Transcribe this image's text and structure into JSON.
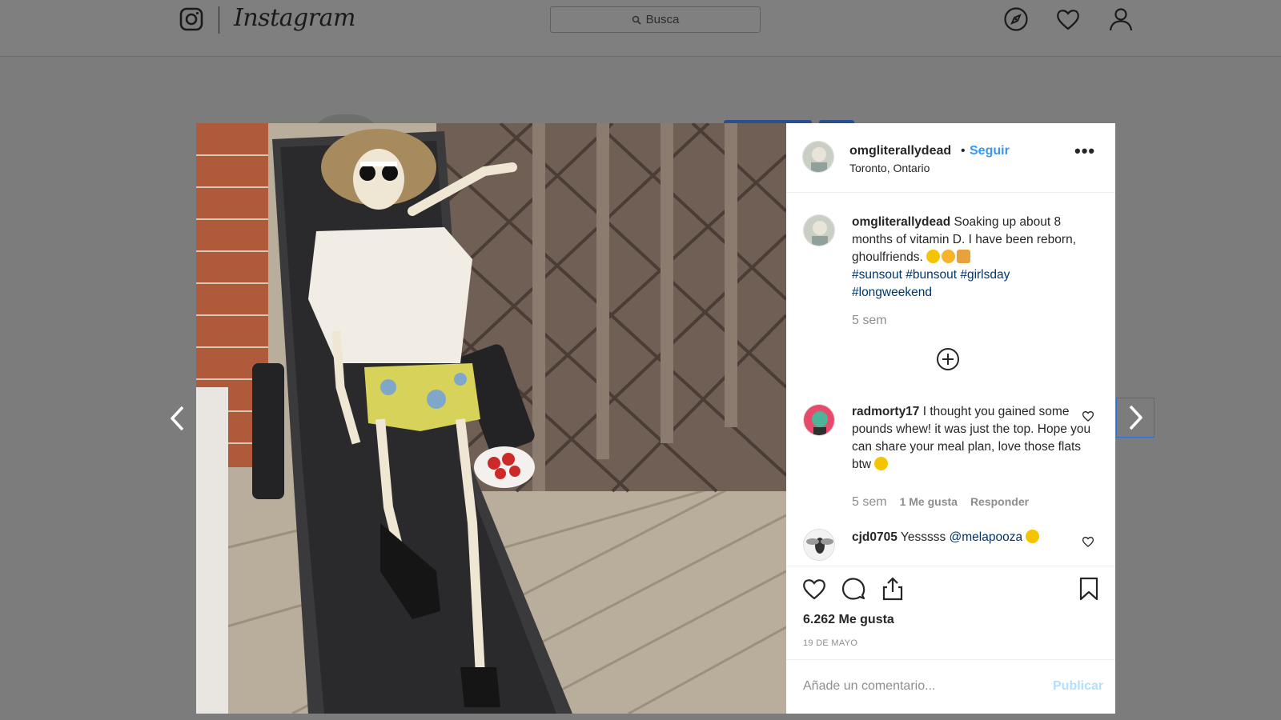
{
  "topbar": {
    "brand": "Instagram",
    "search_placeholder": "Busca",
    "icons": [
      "instagram-logo-icon",
      "compass-icon",
      "heart-icon",
      "profile-icon"
    ]
  },
  "post": {
    "header": {
      "username": "omgliterallydead",
      "separator": "•",
      "follow_label": "Seguir",
      "location": "Toronto, Ontario",
      "more_label": "•••"
    },
    "caption": {
      "username": "omgliterallydead",
      "text": "Soaking up about 8 months of vitamin D. I have been reborn, ghoulfriends.",
      "hashtags": [
        "#sunsout",
        "#bunsout",
        "#girlsday",
        "#longweekend"
      ],
      "time": "5 sem"
    },
    "comments": [
      {
        "username": "radmorty17",
        "text": "I thought you gained some pounds whew! it was just the top. Hope you can share your meal plan, love those flats btw",
        "time": "5 sem",
        "likes": "1 Me gusta",
        "reply_label": "Responder"
      },
      {
        "username": "cjd0705",
        "text": "Yesssss",
        "mention": "@melapooza"
      }
    ],
    "likes_count": "6.262 Me gusta",
    "date": "19 DE MAYO",
    "comment_placeholder": "Añade un comentario...",
    "publish_label": "Publicar"
  },
  "colors": {
    "accent": "#3897f0",
    "hashtag": "#003569",
    "muted": "#8e8e8e",
    "overlay": "#7c7c7c"
  }
}
